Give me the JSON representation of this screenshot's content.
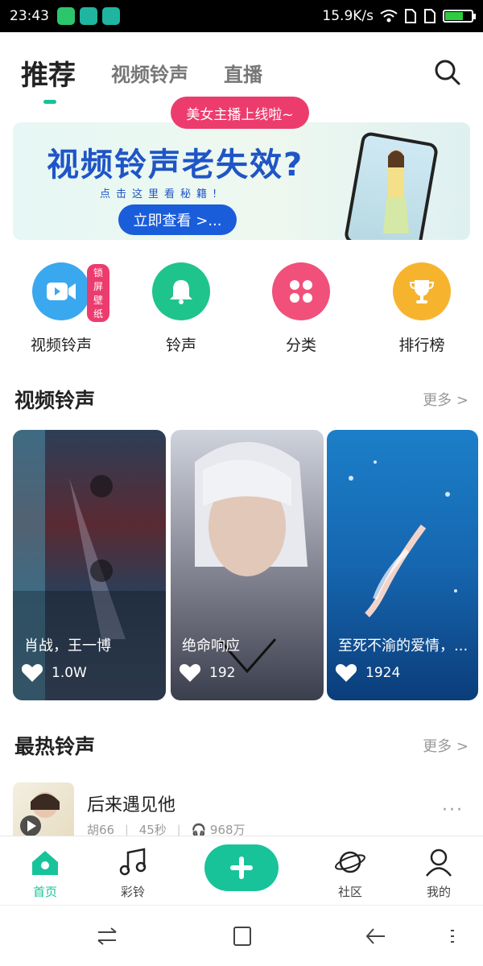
{
  "status_bar": {
    "time": "23:43",
    "network_speed": "15.9K/s",
    "battery_level": 0.7
  },
  "top_tabs": [
    {
      "label": "推荐",
      "active": true
    },
    {
      "label": "视频铃声",
      "active": false
    },
    {
      "label": "直播",
      "active": false
    }
  ],
  "live_pill": "美女主播上线啦~",
  "banner": {
    "headline": "视频铃声老失效?",
    "subtext": "点击这里看秘籍!",
    "button": "立即查看 >..."
  },
  "quick_entries": [
    {
      "label": "视频铃声",
      "badge": "锁屏壁纸",
      "icon": "video-camera-icon",
      "color": "#3aa8ef"
    },
    {
      "label": "铃声",
      "icon": "bell-icon",
      "color": "#1fc48c"
    },
    {
      "label": "分类",
      "icon": "grid-icon",
      "color": "#f0507a"
    },
    {
      "label": "排行榜",
      "icon": "trophy-icon",
      "color": "#f6b42e"
    }
  ],
  "video_section": {
    "title": "视频铃声",
    "more": "更多 >",
    "cards": [
      {
        "title": "肖战，王一博",
        "likes": "1.0W"
      },
      {
        "title": "绝命响应",
        "likes": "192"
      },
      {
        "title": "至死不渝的爱情，...",
        "likes": "1924"
      }
    ]
  },
  "hot_section": {
    "title": "最热铃声",
    "more": "更多 >",
    "songs": [
      {
        "name": "后来遇见他",
        "artist": "胡66",
        "duration": "45秒",
        "plays": "968万"
      }
    ]
  },
  "bottom_nav": [
    {
      "label": "首页",
      "icon": "home-icon",
      "active": true
    },
    {
      "label": "彩铃",
      "icon": "music-note-icon",
      "active": false
    },
    {
      "label": "",
      "icon": "plus-icon",
      "active": false
    },
    {
      "label": "社区",
      "icon": "planet-icon",
      "active": false
    },
    {
      "label": "我的",
      "icon": "person-icon",
      "active": false
    }
  ],
  "colors": {
    "accent": "#19c39a",
    "pink": "#ec3c6d",
    "banner_blue": "#1a5ddb"
  }
}
